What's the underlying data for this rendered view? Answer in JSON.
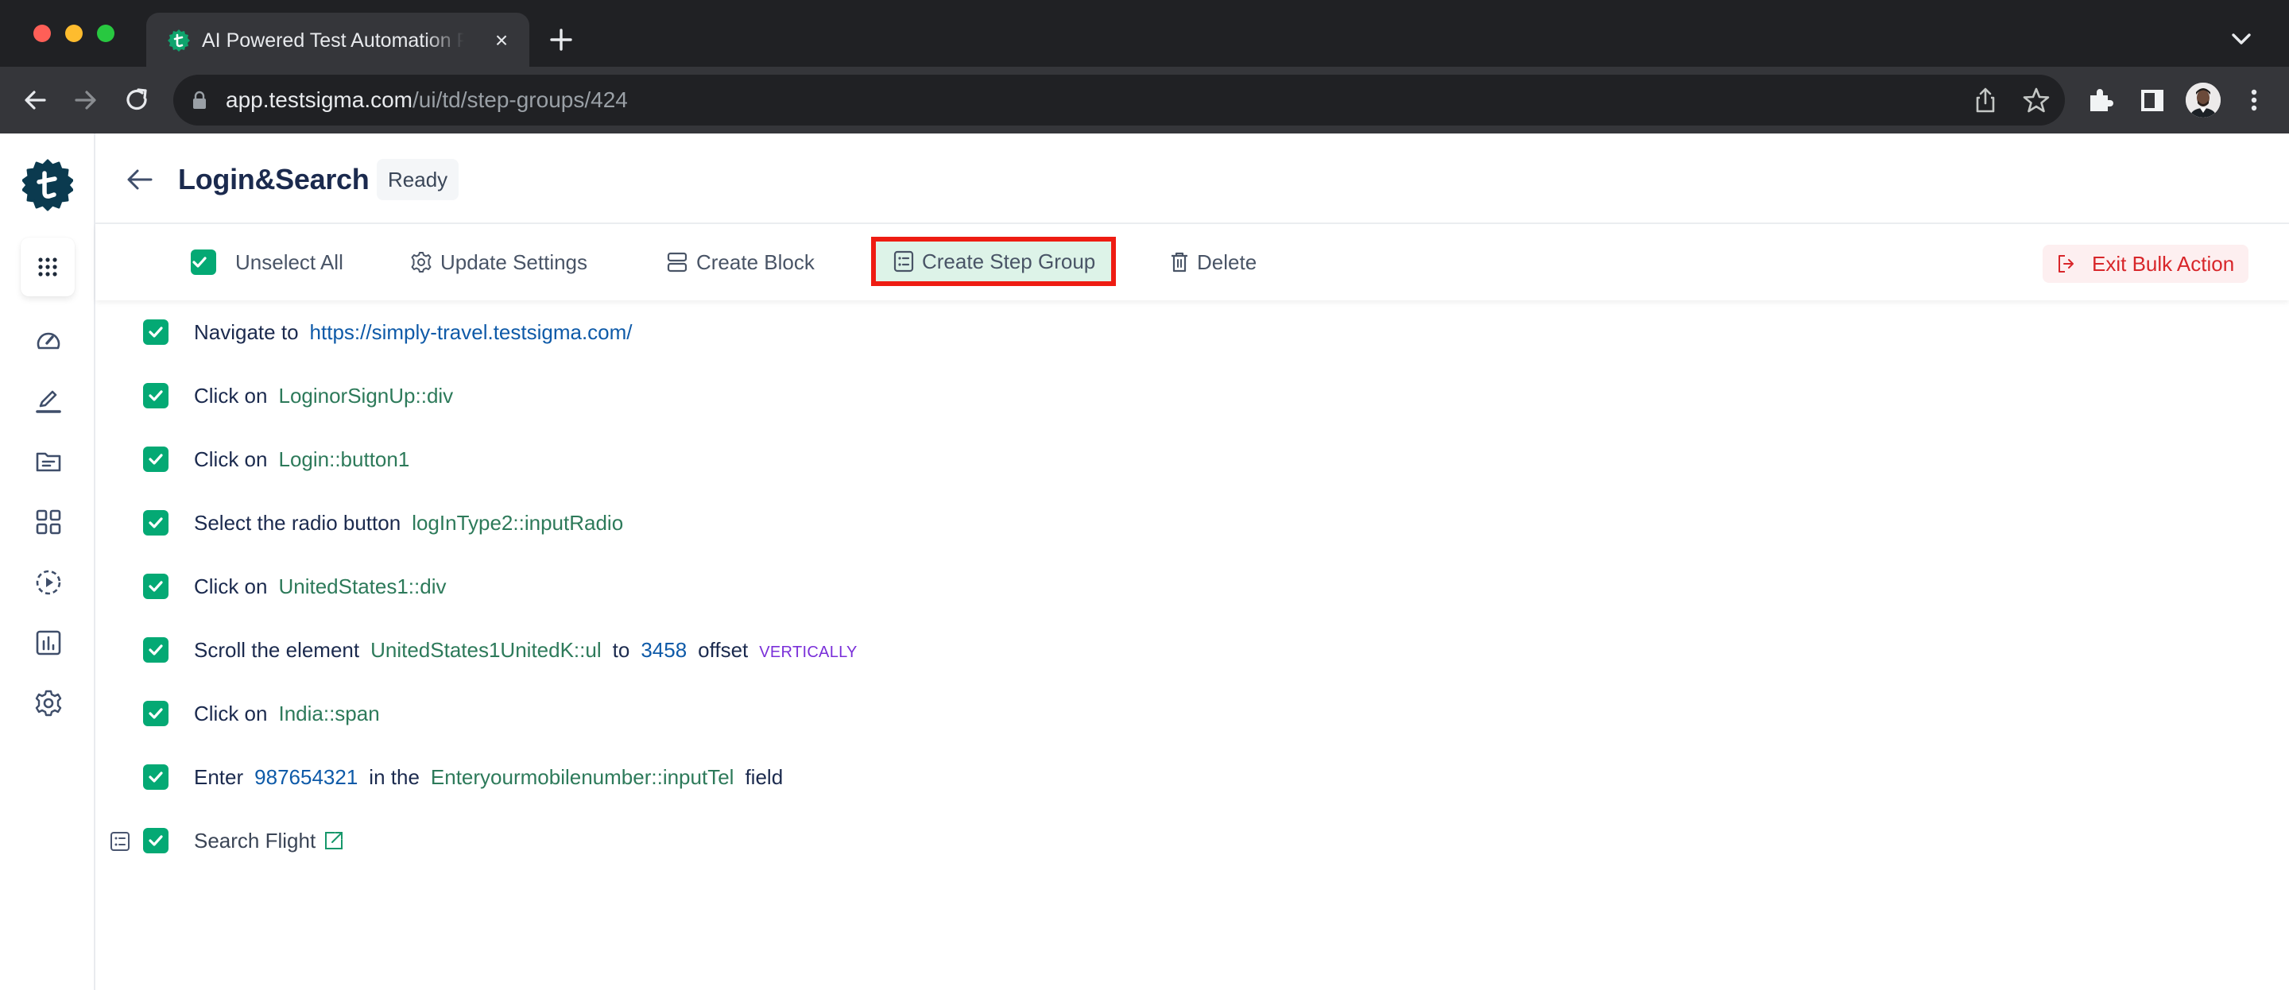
{
  "browser": {
    "tab_title": "AI Powered Test Automation Platform",
    "url_host": "app.testsigma.com",
    "url_path": "/ui/td/step-groups/424",
    "icons": {
      "back": "arrow-left-icon",
      "forward": "arrow-right-icon",
      "reload": "reload-icon",
      "lock": "lock-icon",
      "share": "share-icon",
      "bookmark": "star-icon",
      "extensions": "puzzle-icon",
      "side_panel": "side-panel-icon",
      "profile": "avatar",
      "menu": "kebab-menu-icon",
      "tab_close": "close-icon",
      "new_tab": "plus-icon",
      "tab_search": "chevron-down-icon"
    }
  },
  "sidebar": {
    "logo": "testsigma-logo",
    "items": [
      {
        "name": "dashboard",
        "icon": "speedometer-icon"
      },
      {
        "name": "create-tests",
        "icon": "pencil-icon"
      },
      {
        "name": "test-cases",
        "icon": "folder-icon"
      },
      {
        "name": "apps",
        "icon": "grid-icon"
      },
      {
        "name": "run-results",
        "icon": "play-circle-icon"
      },
      {
        "name": "reports",
        "icon": "bar-chart-icon"
      },
      {
        "name": "settings",
        "icon": "gear-icon"
      }
    ]
  },
  "header": {
    "title": "Login&Search",
    "status": "Ready"
  },
  "bulk_actions": {
    "unselect_all": "Unselect All",
    "update_settings": "Update Settings",
    "create_block": "Create Block",
    "create_step_group": "Create Step Group",
    "delete": "Delete",
    "exit_bulk_action": "Exit Bulk Action",
    "highlighted": "create_step_group"
  },
  "colors": {
    "brand": "#0b3a4f",
    "checkbox": "#04a974",
    "element": "#2d7a5a",
    "link": "#0e5aa8",
    "keyword": "#7a2fd9",
    "danger": "#d8262a",
    "highlight_outline": "#ee1c12"
  },
  "steps": [
    {
      "checked": true,
      "parts": [
        {
          "t": "Navigate to",
          "k": "plain"
        },
        {
          "t": "https://simply-travel.testsigma.com/",
          "k": "url"
        }
      ]
    },
    {
      "checked": true,
      "parts": [
        {
          "t": "Click on",
          "k": "plain"
        },
        {
          "t": "LoginorSignUp::div",
          "k": "element"
        }
      ]
    },
    {
      "checked": true,
      "parts": [
        {
          "t": "Click on",
          "k": "plain"
        },
        {
          "t": "Login::button1",
          "k": "element"
        }
      ]
    },
    {
      "checked": true,
      "parts": [
        {
          "t": "Select the radio button",
          "k": "plain"
        },
        {
          "t": "logInType2::inputRadio",
          "k": "element"
        }
      ]
    },
    {
      "checked": true,
      "parts": [
        {
          "t": "Click on",
          "k": "plain"
        },
        {
          "t": "UnitedStates1::div",
          "k": "element"
        }
      ]
    },
    {
      "checked": true,
      "parts": [
        {
          "t": "Scroll the element",
          "k": "plain"
        },
        {
          "t": "UnitedStates1UnitedK::ul",
          "k": "element"
        },
        {
          "t": "to",
          "k": "plain"
        },
        {
          "t": "3458",
          "k": "number"
        },
        {
          "t": "offset",
          "k": "plain"
        },
        {
          "t": "VERTICALLY",
          "k": "keyword"
        }
      ]
    },
    {
      "checked": true,
      "parts": [
        {
          "t": "Click on",
          "k": "plain"
        },
        {
          "t": "India::span",
          "k": "element"
        }
      ]
    },
    {
      "checked": true,
      "parts": [
        {
          "t": "Enter",
          "k": "plain"
        },
        {
          "t": "987654321",
          "k": "number"
        },
        {
          "t": "in the",
          "k": "plain"
        },
        {
          "t": "Enteryourmobilenumber::inputTel",
          "k": "element"
        },
        {
          "t": "field",
          "k": "plain"
        }
      ]
    },
    {
      "checked": true,
      "step_group": true,
      "parts": [
        {
          "t": "Search Flight",
          "k": "group"
        }
      ]
    }
  ]
}
